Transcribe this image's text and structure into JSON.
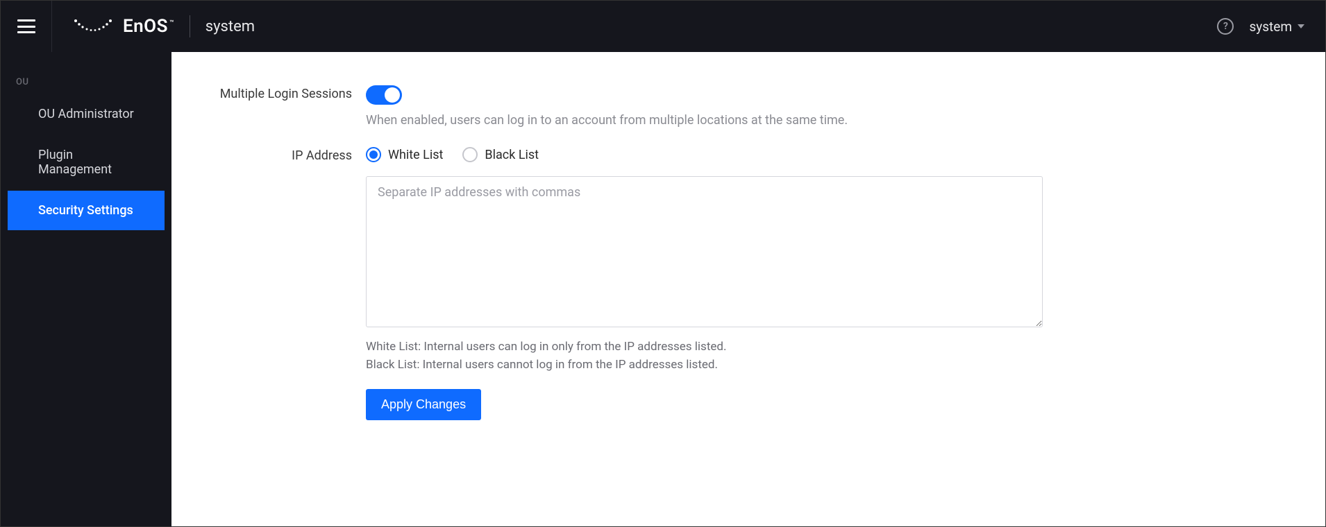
{
  "header": {
    "brand": "EnOS",
    "brand_tm": "™",
    "app": "system",
    "user_label": "system"
  },
  "sidebar": {
    "section": "OU",
    "items": [
      {
        "label": "OU Administrator",
        "active": false
      },
      {
        "label": "Plugin Management",
        "active": false
      },
      {
        "label": "Security Settings",
        "active": true
      }
    ]
  },
  "form": {
    "multiple_login": {
      "label": "Multiple Login Sessions",
      "enabled": true,
      "help": "When enabled, users can log in to an account from multiple locations at the same time."
    },
    "ip": {
      "label": "IP Address",
      "options": {
        "white": "White List",
        "black": "Black List"
      },
      "selected": "white",
      "placeholder": "Separate IP addresses with commas",
      "value": "",
      "help_white": "White List: Internal users can log in only from the IP addresses listed.",
      "help_black": "Black List: Internal users cannot log in from the IP addresses listed."
    },
    "apply_label": "Apply Changes"
  }
}
